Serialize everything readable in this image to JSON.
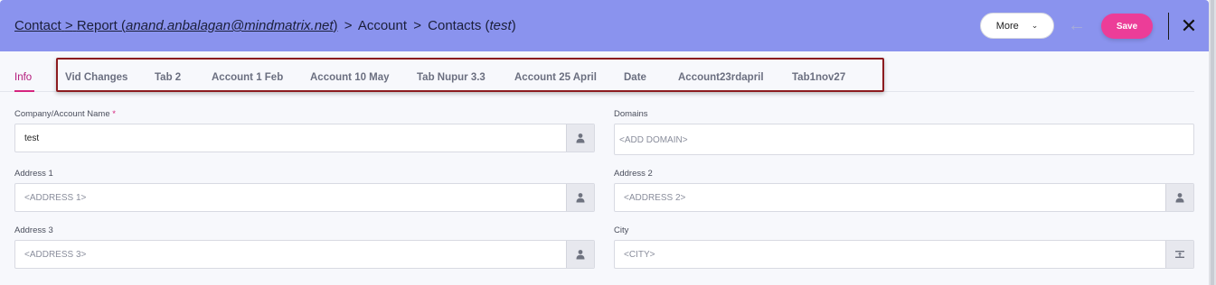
{
  "header": {
    "breadcrumb": {
      "contact": "Contact",
      "report_prefix": "Report (",
      "report_user": "anand.anbalagan@mindmatrix.net",
      "report_suffix": ")",
      "account": "Account",
      "contacts_prefix": "Contacts (",
      "contacts_name": "test",
      "contacts_suffix": ")",
      "separator": ">"
    },
    "more_label": "More",
    "save_label": "Save"
  },
  "tabs": [
    {
      "label": "Info",
      "active": true
    },
    {
      "label": "Vid Changes"
    },
    {
      "label": "Tab 2"
    },
    {
      "label": "Account 1 Feb"
    },
    {
      "label": "Account 10 May"
    },
    {
      "label": "Tab Nupur 3.3"
    },
    {
      "label": "Account 25 April"
    },
    {
      "label": "Date"
    },
    {
      "label": "Account23rdapril"
    },
    {
      "label": "Tab1nov27"
    }
  ],
  "form": {
    "company": {
      "label": "Company/Account Name",
      "required_mark": "*",
      "value": "test"
    },
    "domains": {
      "label": "Domains",
      "placeholder": "<ADD DOMAIN>"
    },
    "address1": {
      "label": "Address 1",
      "placeholder": "<ADDRESS 1>"
    },
    "address2": {
      "label": "Address 2",
      "placeholder": "<ADDRESS 2>"
    },
    "address3": {
      "label": "Address 3",
      "placeholder": "<ADDRESS 3>"
    },
    "city": {
      "label": "City",
      "placeholder": "<CITY>"
    }
  },
  "colors": {
    "header_bg": "#8a93ee",
    "accent_pink": "#ec3d98",
    "active_tab": "#b3197a",
    "highlight_border": "#8c1b1f"
  },
  "icons": {
    "more_chevron": "chevron-down-icon",
    "back": "arrow-left-icon",
    "close": "close-icon",
    "field_addon_person": "person-icon",
    "city_addon": "map-lookup-icon"
  }
}
